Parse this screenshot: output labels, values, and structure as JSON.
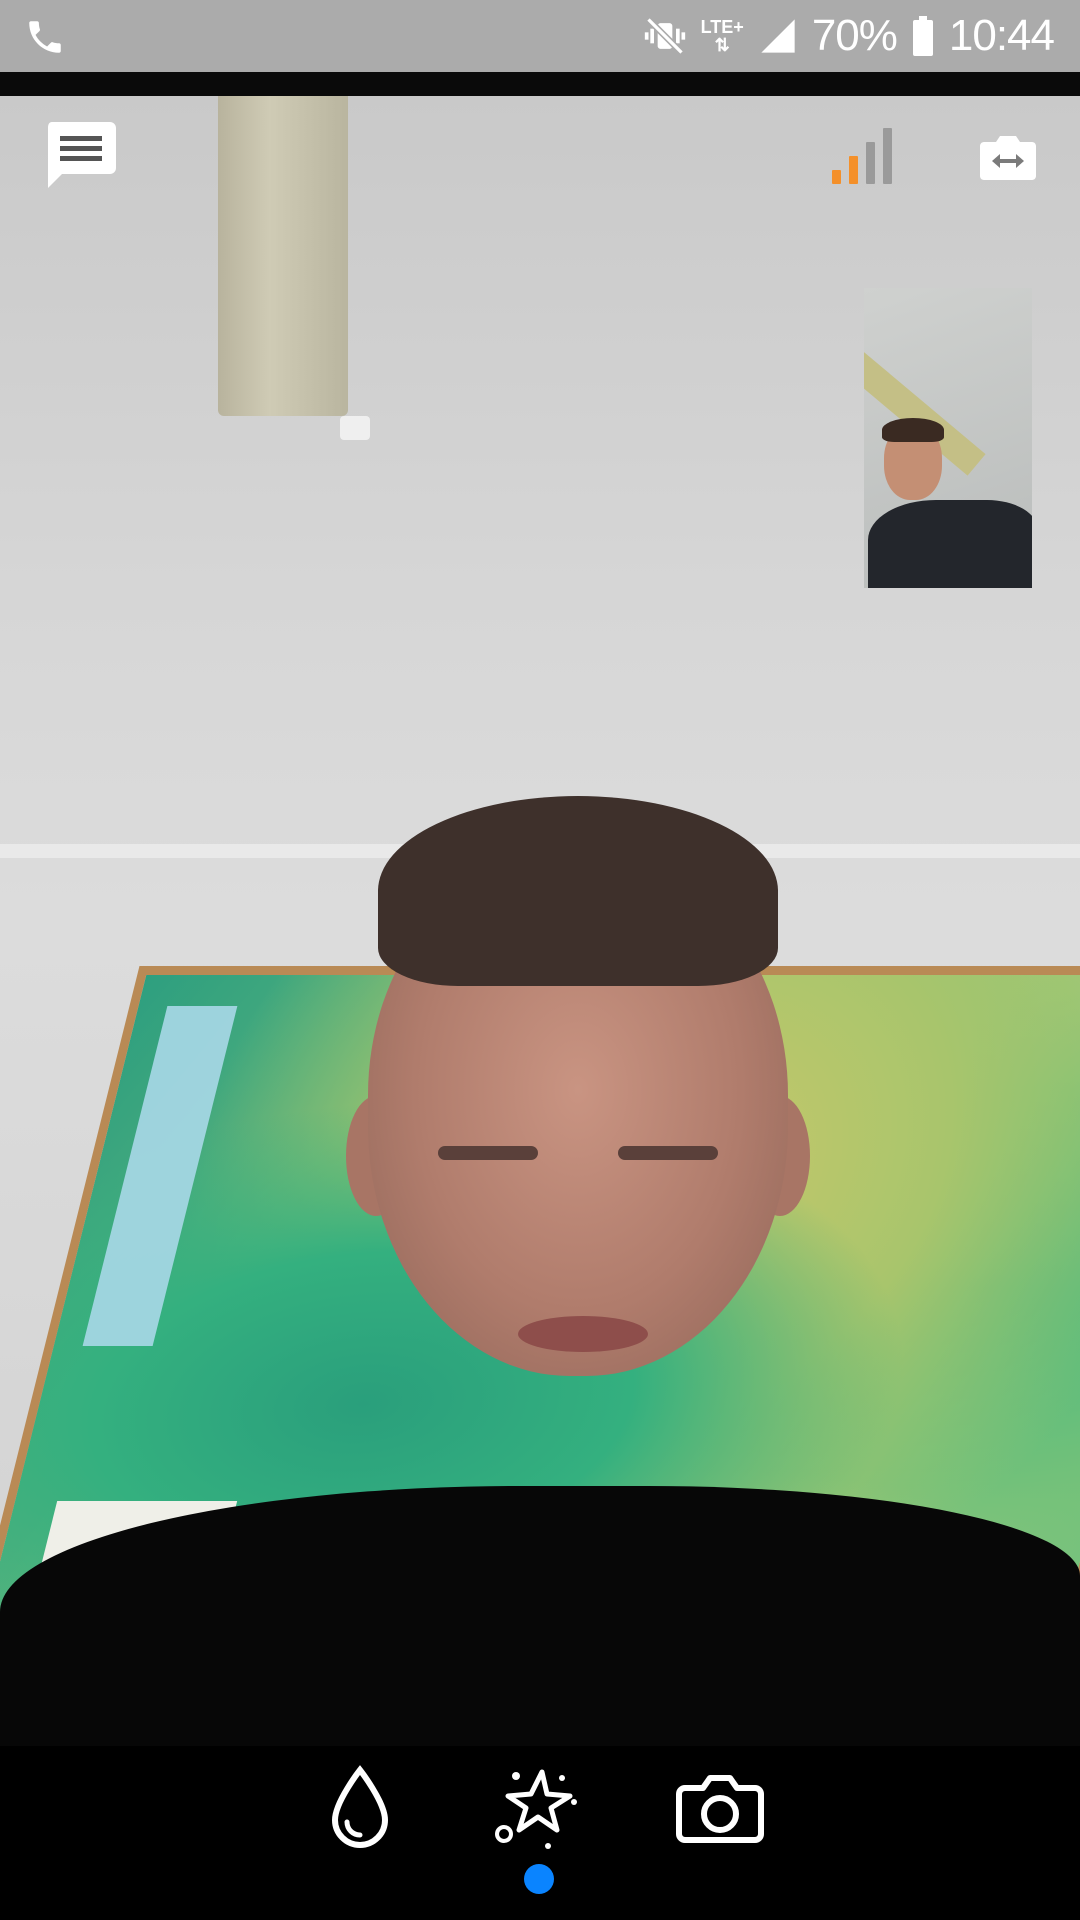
{
  "status_bar": {
    "phone_icon": "phone-icon",
    "mute_icon": "vibrate-mute-icon",
    "network": "LTE+",
    "signal_icon": "signal-icon",
    "battery_percent": "70%",
    "battery_icon": "battery-icon",
    "time": "10:44"
  },
  "call": {
    "chat_icon": "chat-icon",
    "connection_quality_bars": 2,
    "connection_quality_total": 4,
    "quality_active_color": "#f4902a",
    "quality_inactive_color": "#9a9a9a",
    "switch_camera_icon": "switch-camera-icon"
  },
  "controls": {
    "items": [
      {
        "icon": "drop-icon"
      },
      {
        "icon": "effects-star-icon",
        "selected": true
      },
      {
        "icon": "camera-icon"
      }
    ],
    "selected_indicator_color": "#0a84ff"
  }
}
